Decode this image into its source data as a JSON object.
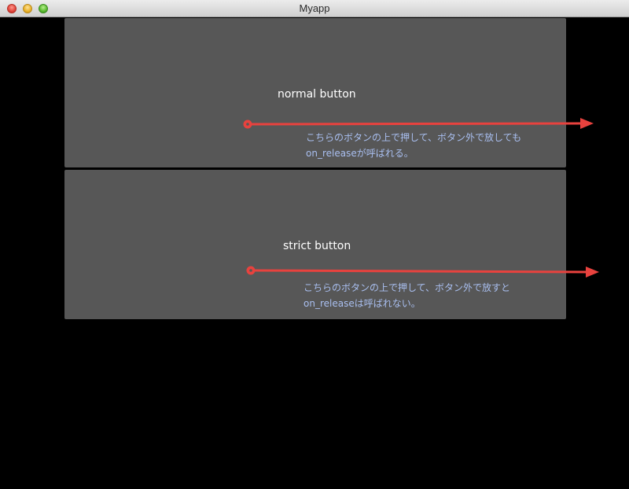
{
  "window": {
    "title": "Myapp"
  },
  "buttons": {
    "normal": {
      "label": "normal button",
      "note_line1": "こちらのボタンの上で押して、ボタン外で放しても",
      "note_line2": "on_releaseが呼ばれる。"
    },
    "strict": {
      "label": "strict button",
      "note_line1": "こちらのボタンの上で押して、ボタン外で放すと",
      "note_line2": "on_releaseは呼ばれない。"
    }
  },
  "colors": {
    "panel": "#575757",
    "background": "#000000",
    "arrow": "#e8423e",
    "note_text": "#a9bff0",
    "label_text": "#ffffff"
  },
  "icons": {
    "arrow": "drag-arrow-icon",
    "close": "close-traffic-light-icon",
    "minimize": "minimize-traffic-light-icon",
    "maximize": "maximize-traffic-light-icon"
  }
}
